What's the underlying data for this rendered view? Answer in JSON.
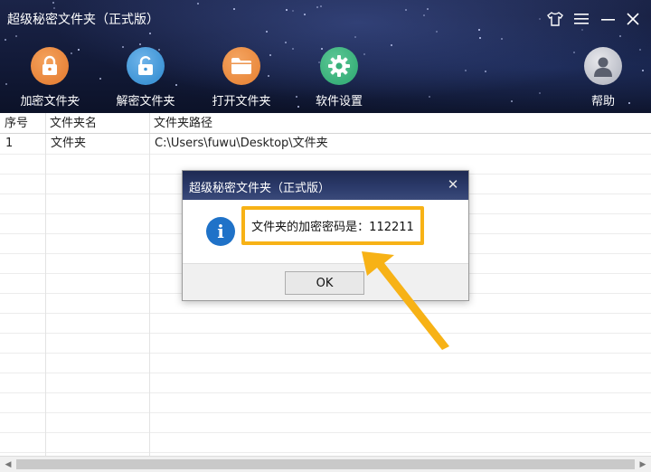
{
  "app": {
    "title": "超级秘密文件夹（正式版）",
    "colors": {
      "header_bg": "#141c3c",
      "lock_orange": "#e8843a",
      "unlock_blue": "#3f95d6",
      "folder_orange": "#ea8a3e",
      "settings_green": "#39b07a",
      "highlight": "#f7b216",
      "info_blue": "#1f72c8"
    }
  },
  "window_controls": [
    {
      "name": "skin",
      "glyph": "shirt-icon"
    },
    {
      "name": "menu",
      "glyph": "menu-icon"
    },
    {
      "name": "minimize",
      "glyph": "minimize-icon"
    },
    {
      "name": "close",
      "glyph": "close-icon"
    }
  ],
  "toolbar": {
    "encrypt_label": "加密文件夹",
    "decrypt_label": "解密文件夹",
    "open_label": "打开文件夹",
    "settings_label": "软件设置",
    "help_label": "帮助"
  },
  "table": {
    "columns": [
      "序号",
      "文件夹名",
      "文件夹路径"
    ],
    "rows": [
      {
        "index": "1",
        "name": "文件夹",
        "path": "C:\\Users\\fuwu\\Desktop\\文件夹"
      }
    ]
  },
  "dialog": {
    "title": "超级秘密文件夹（正式版）",
    "message": "文件夹的加密密码是：112211",
    "ok_label": "OK"
  }
}
